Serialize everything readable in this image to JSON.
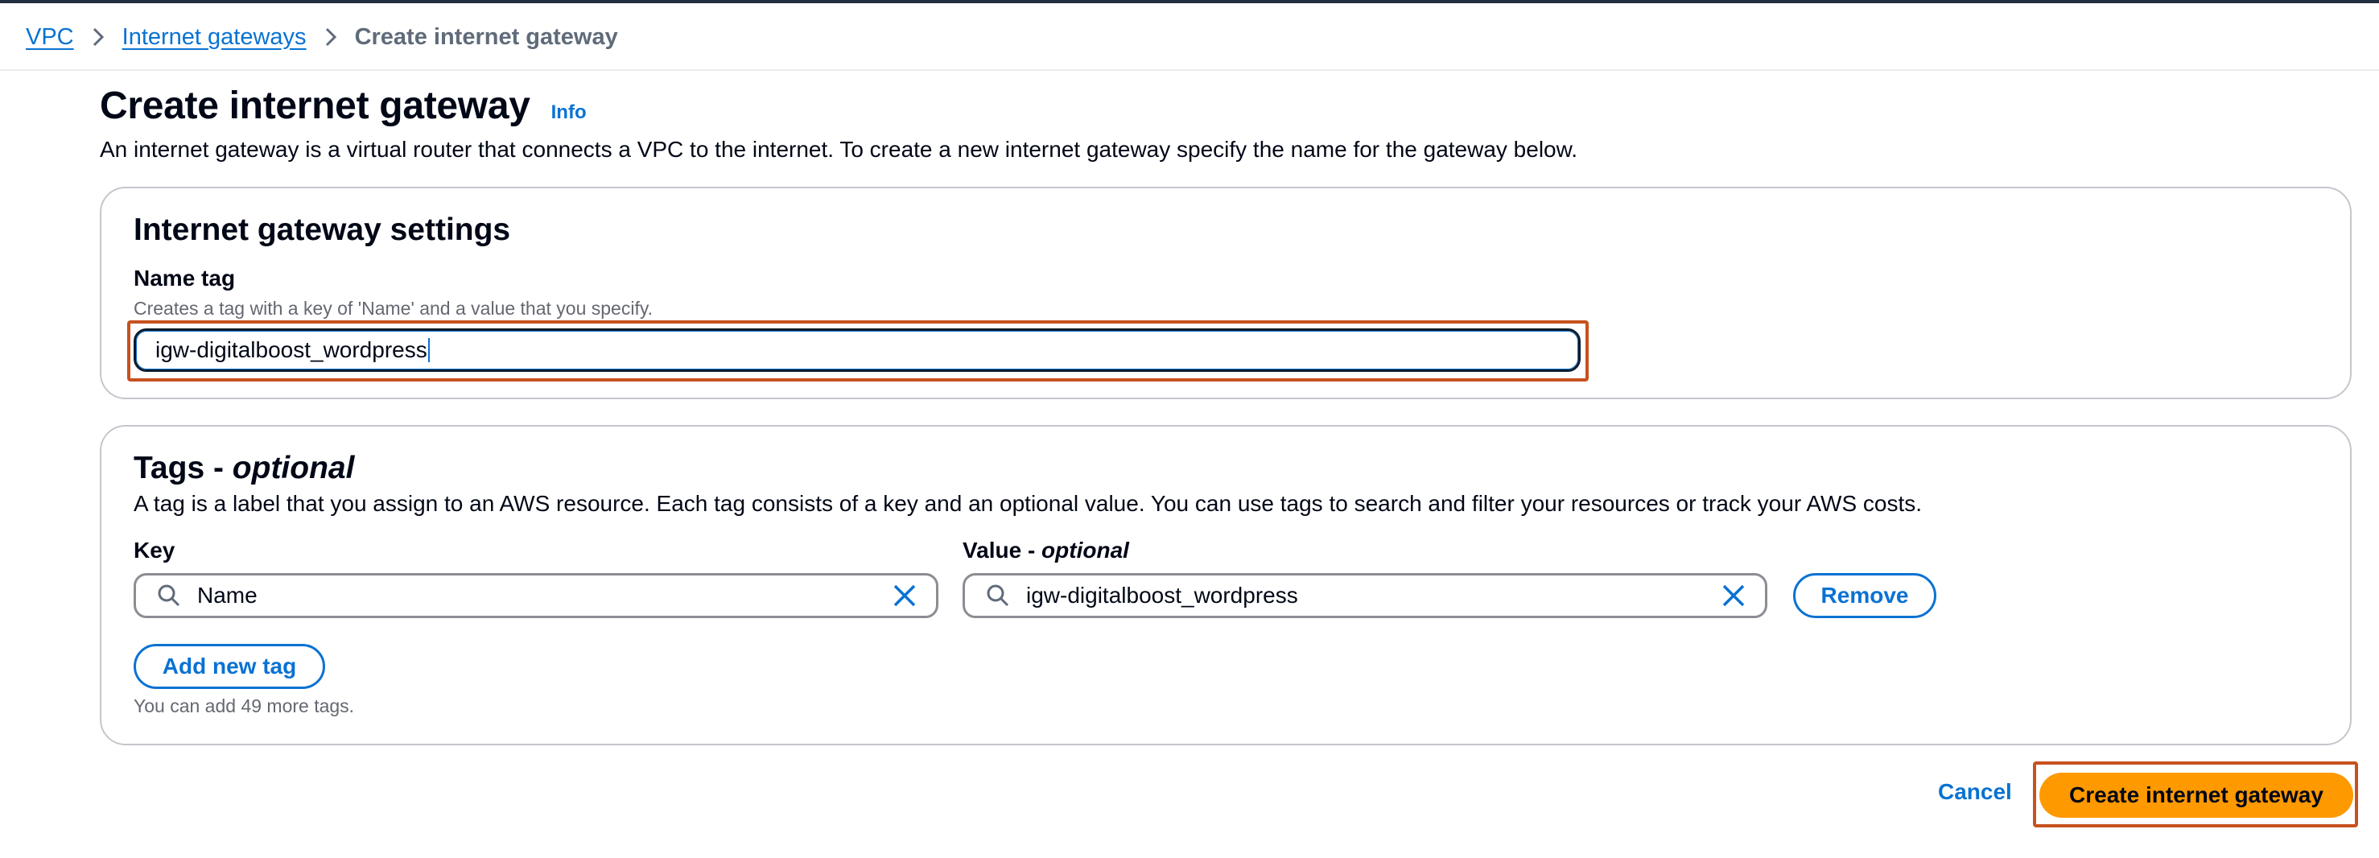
{
  "breadcrumb": {
    "items": [
      "VPC",
      "Internet gateways"
    ],
    "current": "Create internet gateway"
  },
  "header": {
    "title": "Create internet gateway",
    "info": "Info",
    "description": "An internet gateway is a virtual router that connects a VPC to the internet. To create a new internet gateway specify the name for the gateway below."
  },
  "settings": {
    "title": "Internet gateway settings",
    "name_tag_label": "Name tag",
    "name_tag_hint": "Creates a tag with a key of 'Name' and a value that you specify.",
    "name_tag_value": "igw-digitalboost_wordpress"
  },
  "tags": {
    "title_main": "Tags - ",
    "title_optional": "optional",
    "description": "A tag is a label that you assign to an AWS resource. Each tag consists of a key and an optional value. You can use tags to search and filter your resources or track your AWS costs.",
    "key_label": "Key",
    "value_label_main": "Value - ",
    "value_label_optional": "optional",
    "rows": [
      {
        "key": "Name",
        "value": "igw-digitalboost_wordpress",
        "remove_label": "Remove"
      }
    ],
    "add_label": "Add new tag",
    "remaining": "You can add 49 more tags."
  },
  "footer": {
    "cancel_label": "Cancel",
    "submit_label": "Create internet gateway"
  },
  "colors": {
    "link": "#0972d3",
    "primary_button": "#ff9900",
    "highlight": "#c7511f"
  },
  "icons": [
    "chevron-right-icon",
    "search-icon",
    "close-icon"
  ]
}
